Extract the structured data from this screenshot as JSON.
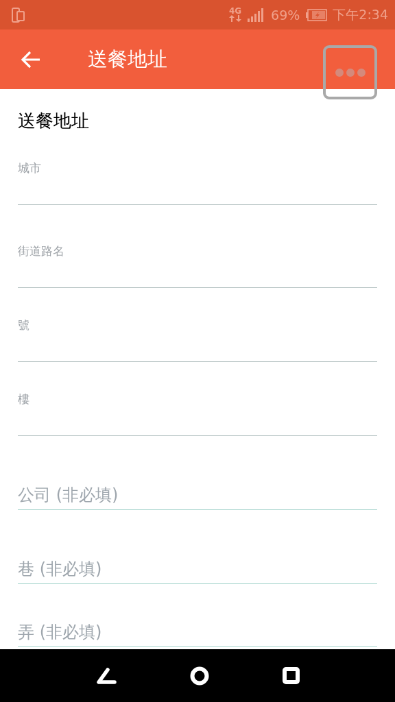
{
  "status_bar": {
    "network": "4G",
    "battery": "69%",
    "time": "下午2:34"
  },
  "app_bar": {
    "title": "送餐地址"
  },
  "form": {
    "title": "送餐地址",
    "fields": [
      {
        "kind": "floating",
        "label": "城市"
      },
      {
        "kind": "floating",
        "label": "街道路名"
      },
      {
        "kind": "floating",
        "label": "號"
      },
      {
        "kind": "floating",
        "label": "樓"
      },
      {
        "kind": "placeholder",
        "placeholder": "公司 (非必填)"
      },
      {
        "kind": "placeholder",
        "placeholder": "巷 (非必填)"
      },
      {
        "kind": "placeholder",
        "placeholder": "弄 (非必填)"
      }
    ]
  }
}
